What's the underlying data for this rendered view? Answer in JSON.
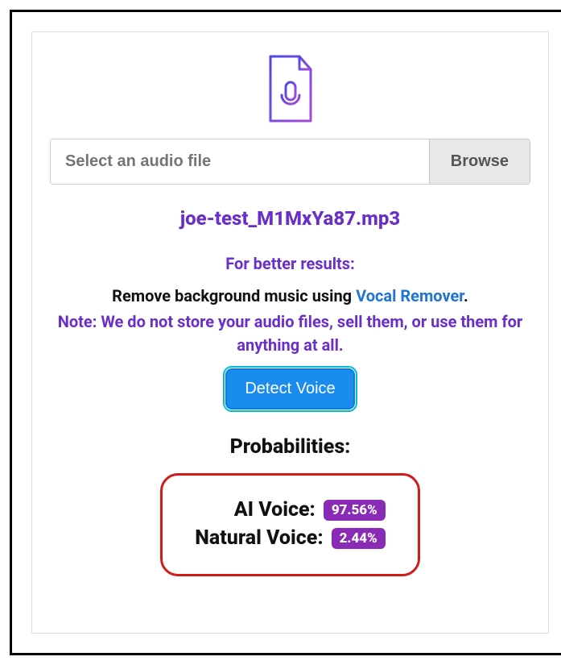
{
  "fileInput": {
    "placeholder": "Select an audio file",
    "browseLabel": "Browse"
  },
  "filename": "joe-test_M1MxYa87.mp3",
  "hints": {
    "title": "For better results:",
    "line1_prefix": "Remove background music using ",
    "line1_link": "Vocal Remover",
    "line1_suffix": ".",
    "note": "Note: We do not store your audio files, sell them, or use them for anything at all."
  },
  "detectLabel": "Detect Voice",
  "probabilities": {
    "title": "Probabilities:",
    "aiLabel": "AI Voice:",
    "aiValue": "97.56%",
    "naturalLabel": "Natural Voice:",
    "naturalValue": "2.44%"
  }
}
